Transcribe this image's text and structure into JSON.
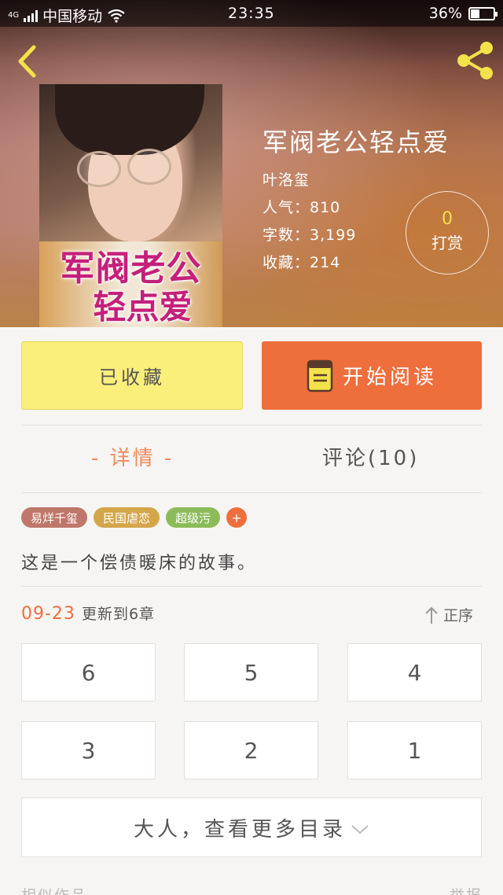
{
  "status_bar": {
    "network": "4G",
    "carrier": "中国移动",
    "time": "23:35",
    "battery": "36%",
    "battery_level": 0.36
  },
  "book": {
    "title": "军阀老公轻点爱",
    "author": "叶洛玺",
    "popularity": "人气：810",
    "word_count": "字数：3,199",
    "favorites": "收藏：214",
    "cover_title_line1": "军阀老公",
    "cover_title_line2": "轻点爱"
  },
  "tip": {
    "count": "0",
    "label": "打赏"
  },
  "actions": {
    "collect_label": "已收藏",
    "read_label": "开始阅读"
  },
  "tabs": [
    {
      "label": "- 详情 -",
      "active": true
    },
    {
      "label": "评论(10)",
      "active": false
    }
  ],
  "tags": [
    {
      "label": "易烊千玺",
      "color": "#c0766a"
    },
    {
      "label": "民国虐恋",
      "color": "#d4a64a"
    },
    {
      "label": "超级污",
      "color": "#8cbc5a"
    },
    {
      "label": "+",
      "color": "#ee6e3c"
    }
  ],
  "description": "这是一个偿债暖床的故事。",
  "update": {
    "date": "09-23",
    "text": "更新到6章"
  },
  "sort_label": "正序",
  "chapters": [
    "6",
    "5",
    "4",
    "3",
    "2",
    "1"
  ],
  "more_label": "大人，查看更多目录",
  "footer": {
    "left": "相似作品",
    "right": "举报"
  },
  "icons": {
    "back": "chevron-left-icon",
    "share": "share-icon",
    "book": "book-icon",
    "sort": "arrow-up-icon",
    "more": "chevron-down-icon"
  },
  "colors": {
    "accent_orange": "#ee6e3c",
    "collect_yellow": "#faef7a",
    "icon_yellow": "#f3e24a"
  }
}
